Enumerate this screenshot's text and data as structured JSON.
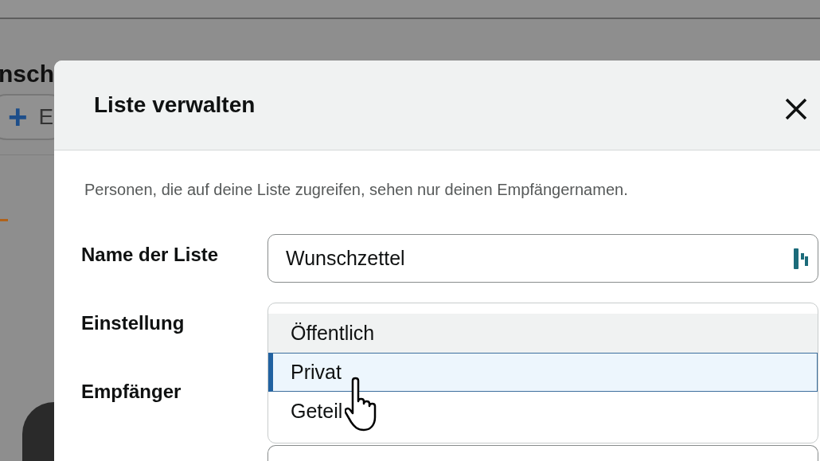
{
  "background_page": {
    "title": "nsch",
    "add_button": {
      "icon": "+",
      "label": "E"
    }
  },
  "dialog": {
    "title": "Liste verwalten",
    "info": "Personen, die auf deine Liste zugreifen, sehen nur deinen Empfängernamen.",
    "fields": [
      {
        "kind": "text",
        "label": "Name der Liste",
        "value": "Wunschzettel"
      },
      {
        "kind": "dropdown",
        "label": "Einstellung",
        "options": [
          {
            "label": "Öffentlich",
            "selected": true,
            "hovered": false
          },
          {
            "label": "Privat",
            "selected": false,
            "hovered": true
          },
          {
            "label": "Geteil",
            "selected": false,
            "hovered": false
          }
        ]
      },
      {
        "kind": "text",
        "label": "Empfänger"
      }
    ]
  }
}
